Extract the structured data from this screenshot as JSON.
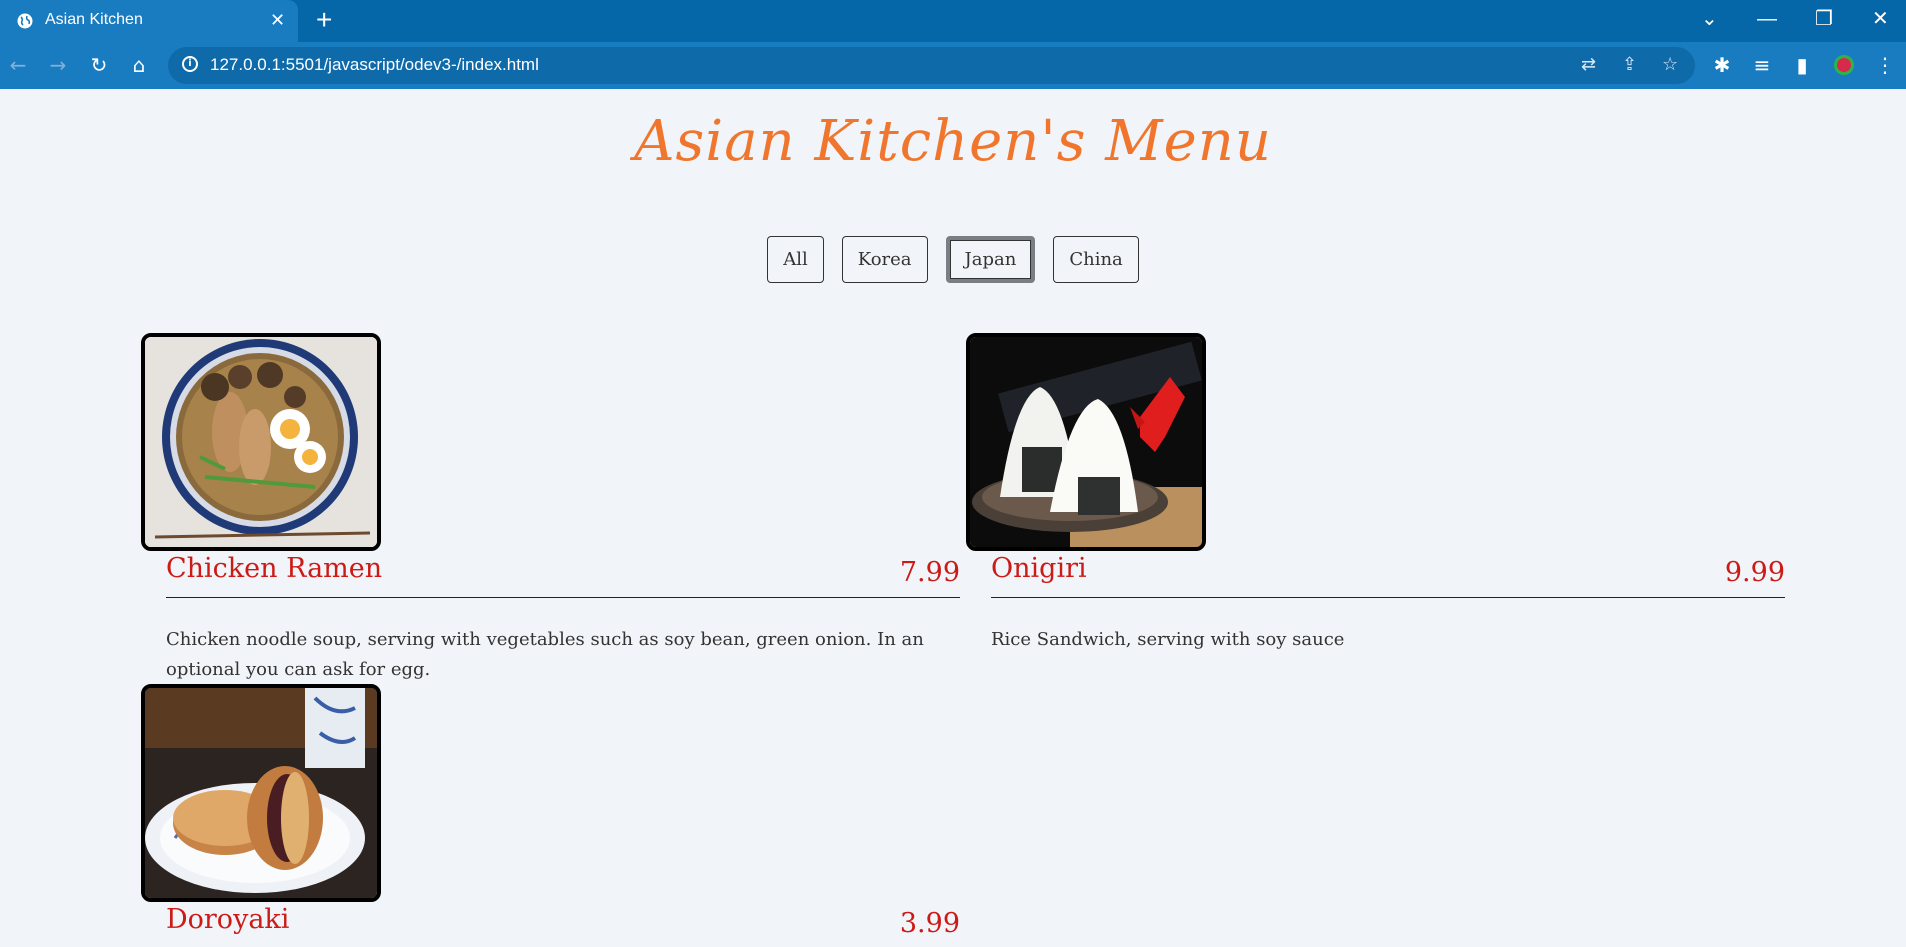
{
  "browser": {
    "tab_title": "Asian Kitchen",
    "url": "127.0.0.1:5501/javascript/odev3-/index.html",
    "new_tab": "+",
    "close_tab": "✕"
  },
  "page": {
    "title": "Asian Kitchen's Menu",
    "filters": [
      {
        "label": "All",
        "active": false
      },
      {
        "label": "Korea",
        "active": false
      },
      {
        "label": "Japan",
        "active": true
      },
      {
        "label": "China",
        "active": false
      }
    ],
    "menu": [
      {
        "name": "Chicken Ramen",
        "price": "7.99",
        "description": "Chicken noodle soup, serving with vegetables such as soy bean, green onion. In an optional you can ask for egg."
      },
      {
        "name": "Onigiri",
        "price": "9.99",
        "description": "Rice Sandwich, serving with soy sauce"
      },
      {
        "name": "Doroyaki",
        "price": "3.99",
        "description": ""
      }
    ]
  },
  "colors": {
    "title": "#f1762d",
    "item_name": "#cc1b17",
    "tabbar": "#0567a7",
    "toolbar": "#1a7cc0"
  }
}
